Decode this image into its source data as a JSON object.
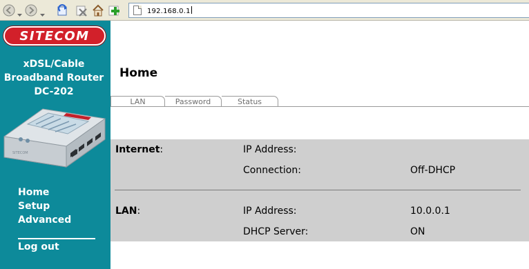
{
  "browser": {
    "address": "192.168.0.1"
  },
  "sidebar": {
    "logo_text": "SITECOM",
    "product_lines": [
      "xDSL/Cable",
      "Broadband Router",
      "DC-202"
    ],
    "nav": [
      {
        "label": "Home"
      },
      {
        "label": "Setup"
      },
      {
        "label": "Advanced"
      }
    ],
    "logout_label": "Log out"
  },
  "main": {
    "title": "Home",
    "tabs": [
      {
        "label": "LAN"
      },
      {
        "label": "Password"
      },
      {
        "label": "Status"
      }
    ],
    "internet": {
      "label": "Internet",
      "suffix": ":",
      "ip_label": "IP Address:",
      "ip_value": "",
      "connection_label": "Connection:",
      "connection_value": "Off-DHCP"
    },
    "lan": {
      "label": "LAN",
      "suffix": ":",
      "ip_label": "IP Address:",
      "ip_value": "10.0.0.1",
      "dhcp_label": "DHCP Server:",
      "dhcp_value": "ON"
    }
  },
  "colors": {
    "sidebar_bg": "#0d8a9a",
    "logo_red": "#d2202a",
    "panel_gray": "#cfcfcf"
  }
}
